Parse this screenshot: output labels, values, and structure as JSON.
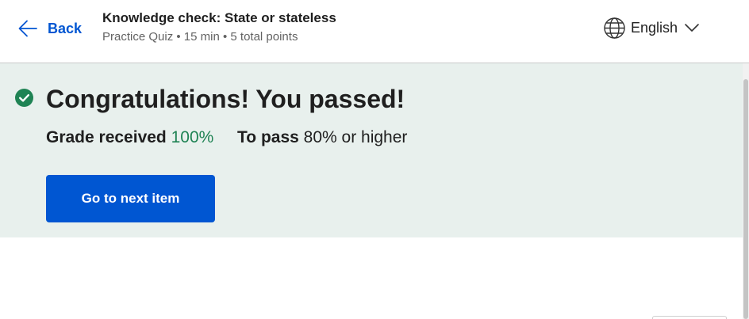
{
  "header": {
    "back_label": "Back",
    "title": "Knowledge check: State or stateless",
    "meta": "Practice Quiz • 15 min • 5 total points",
    "language": "English",
    "icons": {
      "back": "arrow-left-icon",
      "language": "globe-icon",
      "dropdown": "chevron-down-icon"
    }
  },
  "result": {
    "headline": "Congratulations! You passed!",
    "grade_label": "Grade received",
    "grade_value": "100%",
    "pass_label": "To pass",
    "pass_value": "80% or higher",
    "next_button": "Go to next item",
    "icon": "check-circle-icon"
  },
  "colors": {
    "brand_blue": "#0056d2",
    "success_green": "#1f8354",
    "banner_bg": "#e8f0ed"
  }
}
